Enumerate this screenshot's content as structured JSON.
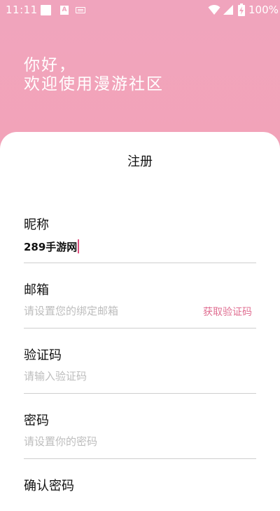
{
  "status_bar": {
    "time": "11:11",
    "battery_percent": "100%",
    "keyboard_badge": "A"
  },
  "greeting": {
    "line1": "你好，",
    "line2": "欢迎使用漫游社区"
  },
  "form": {
    "title": "注册",
    "nickname": {
      "label": "昵称",
      "value": "289手游网"
    },
    "email": {
      "label": "邮箱",
      "placeholder": "请设置您的绑定邮箱",
      "action": "获取验证码"
    },
    "code": {
      "label": "验证码",
      "placeholder": "请输入验证码"
    },
    "password": {
      "label": "密码",
      "placeholder": "请设置你的密码"
    },
    "confirm": {
      "label": "确认密码"
    }
  },
  "colors": {
    "accent": "#e06f92",
    "header_bg": "#f5a2b4",
    "caret": "#e0507f"
  }
}
